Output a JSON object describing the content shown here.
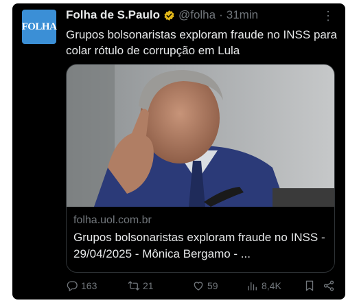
{
  "tweet": {
    "avatar_text": "FOLHA",
    "display_name": "Folha de S.Paulo",
    "handle": "@folha",
    "separator": "·",
    "time": "31min",
    "text": "Grupos bolsonaristas exploram fraude no INSS para colar rótulo de corrupção em Lula",
    "more_icon": "⋮"
  },
  "link_card": {
    "domain": "folha.uol.com.br",
    "title": "Grupos bolsonaristas exploram fraude no INSS - 29/04/2025 - Mônica Bergamo - ..."
  },
  "actions": {
    "replies": "163",
    "reposts": "21",
    "likes": "59",
    "views": "8,4K"
  },
  "colors": {
    "background": "#000000",
    "text": "#e7e9ea",
    "muted": "#71767b",
    "verified": "#e2b719",
    "avatar": "#3b8fd6"
  },
  "icons": [
    "verified-badge-icon",
    "more-options-icon",
    "reply-icon",
    "repost-icon",
    "like-icon",
    "views-icon",
    "bookmark-icon",
    "share-icon"
  ]
}
